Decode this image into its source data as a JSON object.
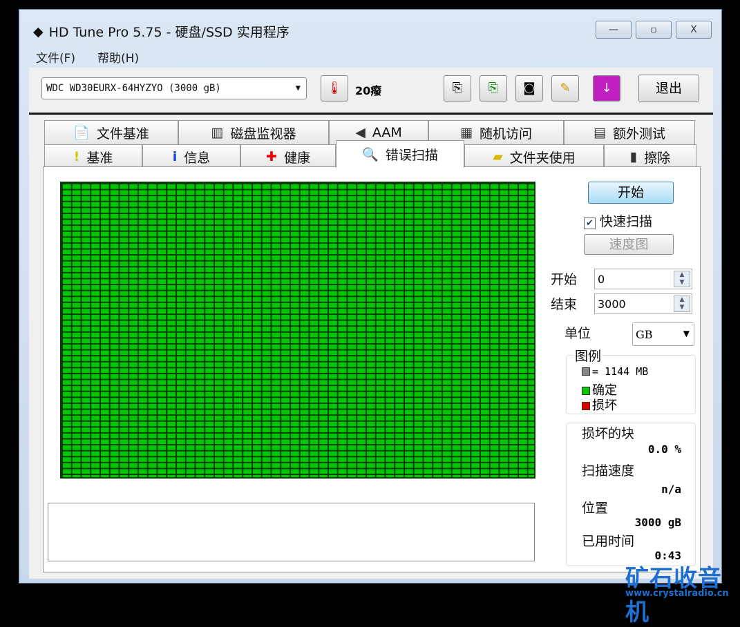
{
  "window": {
    "title": "HD Tune Pro 5.75 - 硬盘/SSD 实用程序",
    "minimize": "—",
    "maximize": "▫",
    "close": "X"
  },
  "menu": [
    "文件(F)",
    "帮助(H)"
  ],
  "toolbar": {
    "drive": "WDC WD30EURX-64HYZYO (3000 gB)",
    "temperature": "20癈",
    "exit": "退出"
  },
  "tabs_top": [
    {
      "label": "文件基准",
      "icon": "file-benchmark-icon"
    },
    {
      "label": "磁盘监视器",
      "icon": "disk-monitor-icon"
    },
    {
      "label": "AAM",
      "icon": "speaker-icon"
    },
    {
      "label": "随机访问",
      "icon": "random-access-icon"
    },
    {
      "label": "额外测试",
      "icon": "extra-tests-icon"
    }
  ],
  "tabs_bottom": [
    {
      "label": "基准",
      "icon": "exclamation-icon"
    },
    {
      "label": "信息",
      "icon": "info-icon"
    },
    {
      "label": "健康",
      "icon": "health-cross-icon"
    },
    {
      "label": "错误扫描",
      "icon": "magnifier-icon"
    },
    {
      "label": "文件夹使用",
      "icon": "folder-icon"
    },
    {
      "label": "擦除",
      "icon": "trash-icon"
    }
  ],
  "controls": {
    "start_button": "开始",
    "quick_scan": "快速扫描",
    "quick_scan_checked": true,
    "speed_map": "速度图",
    "start_label": "开始",
    "start_value": "0",
    "end_label": "结束",
    "end_value": "3000",
    "unit_label": "单位",
    "unit_value": "GB"
  },
  "legend": {
    "title": "图例",
    "block_size": "= 1144 MB",
    "ok": "确定",
    "damaged": "损坏",
    "colors": {
      "block": "#888888",
      "ok": "#00c800",
      "damaged": "#e00000"
    }
  },
  "stats": {
    "damaged_blocks_label": "损坏的块",
    "damaged_blocks": "0.0 %",
    "scan_speed_label": "扫描速度",
    "scan_speed": "n/a",
    "position_label": "位置",
    "position": "3000 gB",
    "elapsed_label": "已用时间",
    "elapsed": "0:43"
  },
  "scan": {
    "blocks_ok_fraction": 1.0
  },
  "watermark": {
    "text": "矿石收音机",
    "url": "www.crystalradio.cn"
  }
}
